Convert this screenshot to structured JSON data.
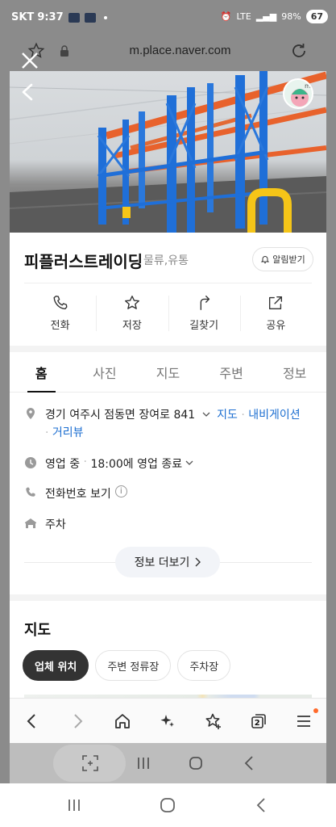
{
  "status_bar": {
    "carrier": "SKT",
    "time": "9:37",
    "network": "LTE",
    "battery": "98%",
    "notification_count": "67"
  },
  "browser": {
    "url": "m.place.naver.com",
    "bottom_bar": {
      "back_icon": "chevron-left-icon",
      "forward_icon": "chevron-right-icon",
      "home_icon": "home-icon",
      "sparkle_icon": "sparkle-icon",
      "bookmark_icon": "star-plus-icon",
      "tabs_count": "2",
      "menu_icon": "hamburger-menu-icon"
    }
  },
  "place": {
    "name": "피플러스트레이딩",
    "category": "물류,유통",
    "alert_button": "알림받기",
    "actions": [
      {
        "label": "전화",
        "icon": "phone-icon"
      },
      {
        "label": "저장",
        "icon": "star-icon"
      },
      {
        "label": "길찾기",
        "icon": "directions-icon"
      },
      {
        "label": "공유",
        "icon": "share-icon"
      }
    ]
  },
  "tabs": [
    {
      "label": "홈",
      "active": true
    },
    {
      "label": "사진",
      "active": false
    },
    {
      "label": "지도",
      "active": false
    },
    {
      "label": "주변",
      "active": false
    },
    {
      "label": "정보",
      "active": false
    }
  ],
  "info": {
    "address": "경기 여주시 점동면 장여로 841",
    "address_links": [
      "지도",
      "내비게이션",
      "거리뷰"
    ],
    "hours_status": "영업 중",
    "hours_detail": "18:00에 영업 종료",
    "phone_label": "전화번호 보기",
    "parking": "주차",
    "more_button": "정보 더보기"
  },
  "map": {
    "title": "지도",
    "chips": [
      {
        "label": "업체 위치",
        "active": true
      },
      {
        "label": "주변 정류장",
        "active": false
      },
      {
        "label": "주차장",
        "active": false
      }
    ]
  },
  "colors": {
    "link": "#1d6fd1",
    "rack_blue": "#1f6fd8",
    "rack_orange": "#e8622c",
    "active_chip": "#333333"
  }
}
